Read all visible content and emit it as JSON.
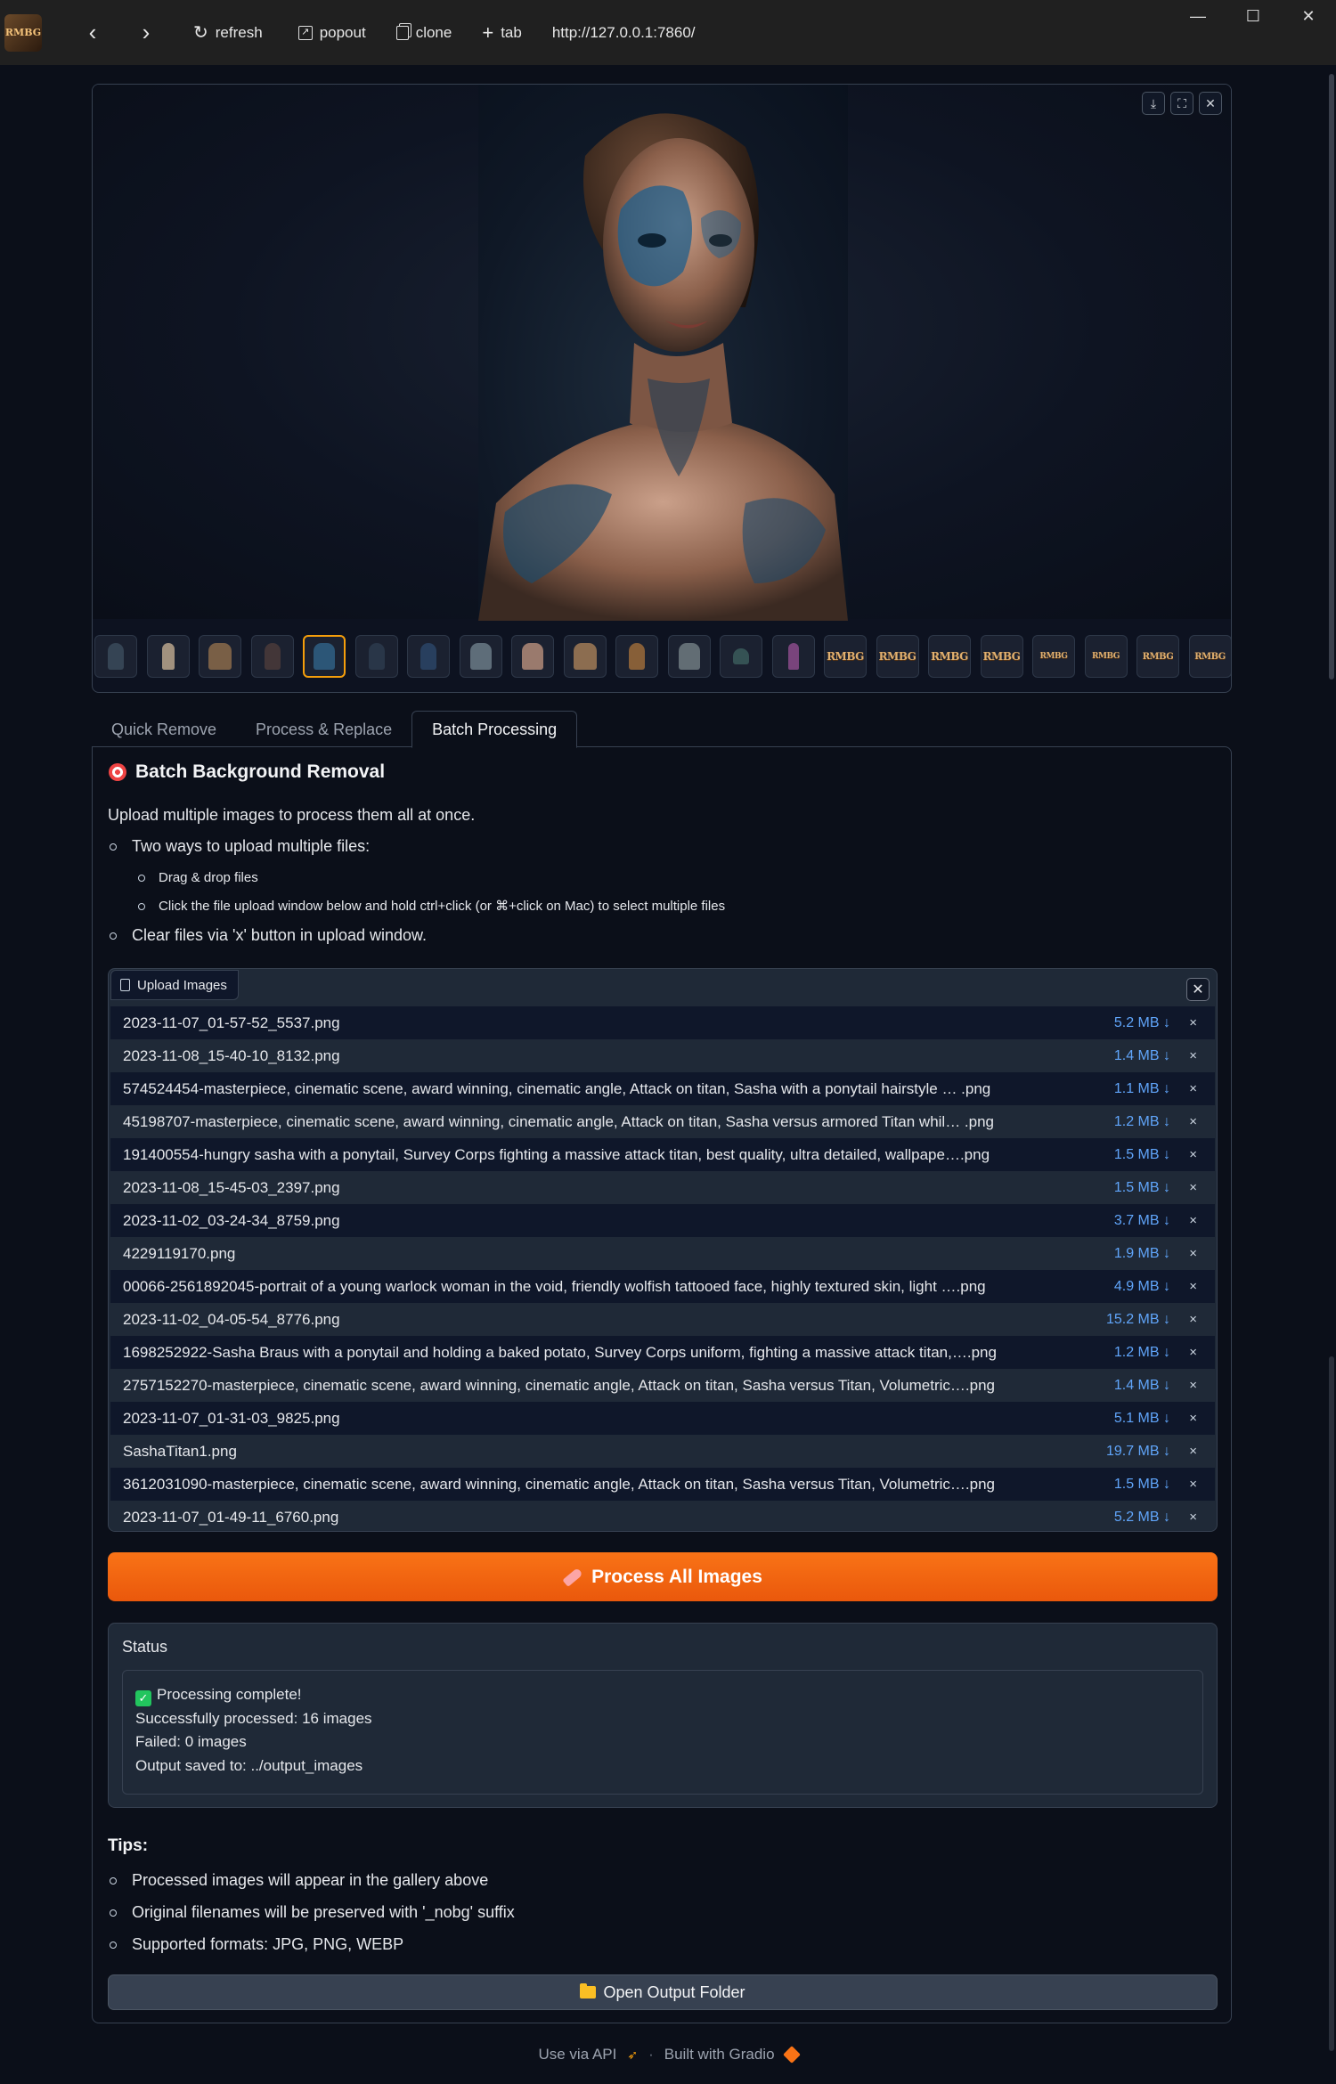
{
  "titlebar": {
    "app_logo": "RMBG",
    "refresh_label": "refresh",
    "popout_label": "popout",
    "clone_label": "clone",
    "tab_label": "tab",
    "url": "http://127.0.0.1:7860/",
    "icons": [
      "back-icon",
      "forward-icon",
      "refresh-icon",
      "popout-icon",
      "clone-icon",
      "plus-icon",
      "minimize-icon",
      "maximize-icon",
      "close-icon"
    ]
  },
  "gallery": {
    "selected_index": 4,
    "thumbnail_count": 22,
    "rmbg_thumb_text": "RMBG",
    "tools": [
      "download-icon",
      "fullscreen-icon",
      "close-icon"
    ]
  },
  "tabs": [
    {
      "label": "Quick Remove",
      "active": false
    },
    {
      "label": "Process & Replace",
      "active": false
    },
    {
      "label": "Batch Processing",
      "active": true
    }
  ],
  "batch": {
    "title": "Batch Background Removal",
    "description": "Upload multiple images to process them all at once.",
    "bullets": {
      "b1": "Two ways to upload multiple files:",
      "b1a": "Drag & drop files",
      "b1b": "Click the file upload window below and hold ctrl+click (or ⌘+click on Mac) to select multiple files",
      "b2": "Clear files via 'x' button in upload window."
    },
    "upload_label": "Upload Images",
    "files": [
      {
        "name": "2023-11-07_01-57-52_5537.png",
        "size": "5.2 MB ↓"
      },
      {
        "name": "2023-11-08_15-40-10_8132.png",
        "size": "1.4 MB ↓"
      },
      {
        "name": "574524454-masterpiece, cinematic scene, award winning, cinematic angle, Attack on titan, Sasha with a ponytail hairstyle …  .png",
        "size": "1.1 MB ↓"
      },
      {
        "name": "45198707-masterpiece, cinematic scene, award winning, cinematic angle, Attack on titan, Sasha versus armored Titan whil… .png",
        "size": "1.2 MB ↓"
      },
      {
        "name": "191400554-hungry sasha with a ponytail, Survey Corps fighting a massive attack titan, best quality, ultra detailed, wallpape….png",
        "size": "1.5 MB ↓"
      },
      {
        "name": "2023-11-08_15-45-03_2397.png",
        "size": "1.5 MB ↓"
      },
      {
        "name": "2023-11-02_03-24-34_8759.png",
        "size": "3.7 MB ↓"
      },
      {
        "name": "4229119170.png",
        "size": "1.9 MB ↓"
      },
      {
        "name": "00066-2561892045-portrait of a young warlock woman in the void, friendly wolfish tattooed face, highly textured skin, light ….png",
        "size": "4.9 MB ↓"
      },
      {
        "name": "2023-11-02_04-05-54_8776.png",
        "size": "15.2 MB ↓"
      },
      {
        "name": "1698252922-Sasha Braus with a ponytail and holding a baked potato, Survey Corps uniform, fighting a massive attack titan,….png",
        "size": "1.2 MB ↓"
      },
      {
        "name": "2757152270-masterpiece, cinematic scene, award winning, cinematic angle, Attack on titan, Sasha versus Titan, Volumetric….png",
        "size": "1.4 MB ↓"
      },
      {
        "name": "2023-11-07_01-31-03_9825.png",
        "size": "5.1 MB ↓"
      },
      {
        "name": "SashaTitan1.png",
        "size": "19.7 MB ↓"
      },
      {
        "name": "3612031090-masterpiece, cinematic scene, award winning, cinematic angle, Attack on titan, Sasha versus Titan, Volumetric….png",
        "size": "1.5 MB ↓"
      },
      {
        "name": "2023-11-07_01-49-11_6760.png",
        "size": "5.2 MB ↓"
      }
    ],
    "process_button": "Process All Images",
    "status_label": "Status",
    "status_lines": {
      "l1": "Processing complete!",
      "l2": "Successfully processed: 16 images",
      "l3": "Failed: 0 images",
      "l4": "Output saved to: ../output_images"
    },
    "tips_title": "Tips:",
    "tips": {
      "t1": "Processed images will appear in the gallery above",
      "t2": "Original filenames will be preserved with '_nobg' suffix",
      "t3": "Supported formats: JPG, PNG, WEBP"
    },
    "open_folder_button": "Open Output Folder"
  },
  "footer": {
    "api": "Use via API",
    "separator": "·",
    "built": "Built with Gradio"
  },
  "colors": {
    "background": "#0b0f19",
    "accent": "#f97316",
    "size_link": "#60a5fa",
    "selected_thumb": "#f59e0b"
  }
}
